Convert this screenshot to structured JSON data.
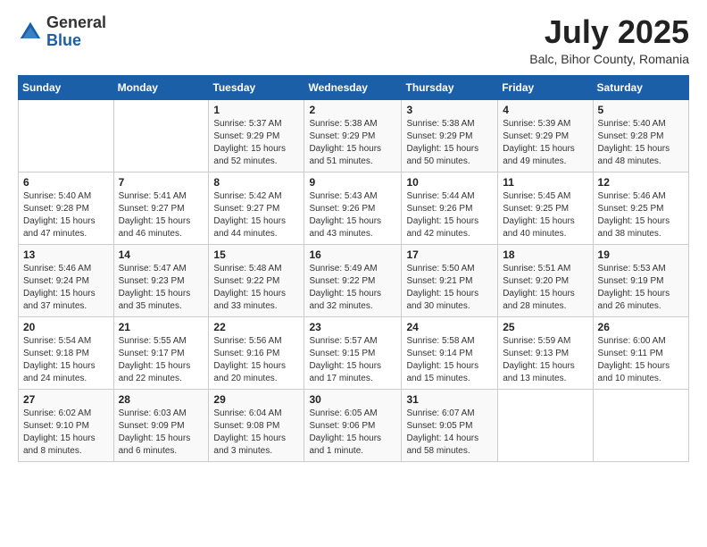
{
  "logo": {
    "general": "General",
    "blue": "Blue"
  },
  "title": {
    "month": "July 2025",
    "location": "Balc, Bihor County, Romania"
  },
  "days_header": [
    "Sunday",
    "Monday",
    "Tuesday",
    "Wednesday",
    "Thursday",
    "Friday",
    "Saturday"
  ],
  "weeks": [
    [
      {
        "day": "",
        "sunrise": "",
        "sunset": "",
        "daylight": ""
      },
      {
        "day": "",
        "sunrise": "",
        "sunset": "",
        "daylight": ""
      },
      {
        "day": "1",
        "sunrise": "Sunrise: 5:37 AM",
        "sunset": "Sunset: 9:29 PM",
        "daylight": "Daylight: 15 hours and 52 minutes."
      },
      {
        "day": "2",
        "sunrise": "Sunrise: 5:38 AM",
        "sunset": "Sunset: 9:29 PM",
        "daylight": "Daylight: 15 hours and 51 minutes."
      },
      {
        "day": "3",
        "sunrise": "Sunrise: 5:38 AM",
        "sunset": "Sunset: 9:29 PM",
        "daylight": "Daylight: 15 hours and 50 minutes."
      },
      {
        "day": "4",
        "sunrise": "Sunrise: 5:39 AM",
        "sunset": "Sunset: 9:29 PM",
        "daylight": "Daylight: 15 hours and 49 minutes."
      },
      {
        "day": "5",
        "sunrise": "Sunrise: 5:40 AM",
        "sunset": "Sunset: 9:28 PM",
        "daylight": "Daylight: 15 hours and 48 minutes."
      }
    ],
    [
      {
        "day": "6",
        "sunrise": "Sunrise: 5:40 AM",
        "sunset": "Sunset: 9:28 PM",
        "daylight": "Daylight: 15 hours and 47 minutes."
      },
      {
        "day": "7",
        "sunrise": "Sunrise: 5:41 AM",
        "sunset": "Sunset: 9:27 PM",
        "daylight": "Daylight: 15 hours and 46 minutes."
      },
      {
        "day": "8",
        "sunrise": "Sunrise: 5:42 AM",
        "sunset": "Sunset: 9:27 PM",
        "daylight": "Daylight: 15 hours and 44 minutes."
      },
      {
        "day": "9",
        "sunrise": "Sunrise: 5:43 AM",
        "sunset": "Sunset: 9:26 PM",
        "daylight": "Daylight: 15 hours and 43 minutes."
      },
      {
        "day": "10",
        "sunrise": "Sunrise: 5:44 AM",
        "sunset": "Sunset: 9:26 PM",
        "daylight": "Daylight: 15 hours and 42 minutes."
      },
      {
        "day": "11",
        "sunrise": "Sunrise: 5:45 AM",
        "sunset": "Sunset: 9:25 PM",
        "daylight": "Daylight: 15 hours and 40 minutes."
      },
      {
        "day": "12",
        "sunrise": "Sunrise: 5:46 AM",
        "sunset": "Sunset: 9:25 PM",
        "daylight": "Daylight: 15 hours and 38 minutes."
      }
    ],
    [
      {
        "day": "13",
        "sunrise": "Sunrise: 5:46 AM",
        "sunset": "Sunset: 9:24 PM",
        "daylight": "Daylight: 15 hours and 37 minutes."
      },
      {
        "day": "14",
        "sunrise": "Sunrise: 5:47 AM",
        "sunset": "Sunset: 9:23 PM",
        "daylight": "Daylight: 15 hours and 35 minutes."
      },
      {
        "day": "15",
        "sunrise": "Sunrise: 5:48 AM",
        "sunset": "Sunset: 9:22 PM",
        "daylight": "Daylight: 15 hours and 33 minutes."
      },
      {
        "day": "16",
        "sunrise": "Sunrise: 5:49 AM",
        "sunset": "Sunset: 9:22 PM",
        "daylight": "Daylight: 15 hours and 32 minutes."
      },
      {
        "day": "17",
        "sunrise": "Sunrise: 5:50 AM",
        "sunset": "Sunset: 9:21 PM",
        "daylight": "Daylight: 15 hours and 30 minutes."
      },
      {
        "day": "18",
        "sunrise": "Sunrise: 5:51 AM",
        "sunset": "Sunset: 9:20 PM",
        "daylight": "Daylight: 15 hours and 28 minutes."
      },
      {
        "day": "19",
        "sunrise": "Sunrise: 5:53 AM",
        "sunset": "Sunset: 9:19 PM",
        "daylight": "Daylight: 15 hours and 26 minutes."
      }
    ],
    [
      {
        "day": "20",
        "sunrise": "Sunrise: 5:54 AM",
        "sunset": "Sunset: 9:18 PM",
        "daylight": "Daylight: 15 hours and 24 minutes."
      },
      {
        "day": "21",
        "sunrise": "Sunrise: 5:55 AM",
        "sunset": "Sunset: 9:17 PM",
        "daylight": "Daylight: 15 hours and 22 minutes."
      },
      {
        "day": "22",
        "sunrise": "Sunrise: 5:56 AM",
        "sunset": "Sunset: 9:16 PM",
        "daylight": "Daylight: 15 hours and 20 minutes."
      },
      {
        "day": "23",
        "sunrise": "Sunrise: 5:57 AM",
        "sunset": "Sunset: 9:15 PM",
        "daylight": "Daylight: 15 hours and 17 minutes."
      },
      {
        "day": "24",
        "sunrise": "Sunrise: 5:58 AM",
        "sunset": "Sunset: 9:14 PM",
        "daylight": "Daylight: 15 hours and 15 minutes."
      },
      {
        "day": "25",
        "sunrise": "Sunrise: 5:59 AM",
        "sunset": "Sunset: 9:13 PM",
        "daylight": "Daylight: 15 hours and 13 minutes."
      },
      {
        "day": "26",
        "sunrise": "Sunrise: 6:00 AM",
        "sunset": "Sunset: 9:11 PM",
        "daylight": "Daylight: 15 hours and 10 minutes."
      }
    ],
    [
      {
        "day": "27",
        "sunrise": "Sunrise: 6:02 AM",
        "sunset": "Sunset: 9:10 PM",
        "daylight": "Daylight: 15 hours and 8 minutes."
      },
      {
        "day": "28",
        "sunrise": "Sunrise: 6:03 AM",
        "sunset": "Sunset: 9:09 PM",
        "daylight": "Daylight: 15 hours and 6 minutes."
      },
      {
        "day": "29",
        "sunrise": "Sunrise: 6:04 AM",
        "sunset": "Sunset: 9:08 PM",
        "daylight": "Daylight: 15 hours and 3 minutes."
      },
      {
        "day": "30",
        "sunrise": "Sunrise: 6:05 AM",
        "sunset": "Sunset: 9:06 PM",
        "daylight": "Daylight: 15 hours and 1 minute."
      },
      {
        "day": "31",
        "sunrise": "Sunrise: 6:07 AM",
        "sunset": "Sunset: 9:05 PM",
        "daylight": "Daylight: 14 hours and 58 minutes."
      },
      {
        "day": "",
        "sunrise": "",
        "sunset": "",
        "daylight": ""
      },
      {
        "day": "",
        "sunrise": "",
        "sunset": "",
        "daylight": ""
      }
    ]
  ]
}
